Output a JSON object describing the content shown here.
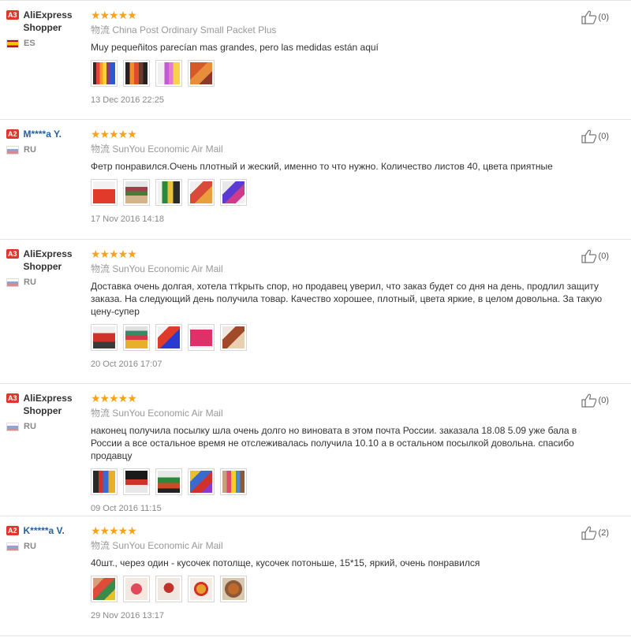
{
  "reviews": [
    {
      "level": "A3",
      "name": "AliExpress Shopper",
      "masked": false,
      "country": "ES",
      "flag": "es",
      "stars": "★★★★★",
      "shipping": "物流 China Post Ordinary Small Packet Plus",
      "text": "Muy pequeñitos parecían mas grandes, pero las medidas están aquí",
      "photos": [
        "linear-gradient(90deg,#3a2a20 0 15%,#e2473a 15% 30%,#f59a2a 30% 45%,#ffd23a 45% 60%,#8b3a7a 60% 75%,#2a5ad0 75% 100%)",
        "linear-gradient(90deg,#2a2020 0 20%,#f28c28 20% 40%,#e34a33 40% 60%,#6a3a2a 60% 80%,#222 80% 100%)",
        "linear-gradient(90deg,#f0f0f0 0 30%,#c15ad4 30% 50%,#e67acb 50% 70%,#f7d24a 70% 100%)",
        "linear-gradient(135deg,#d25a2a 0 40%,#e88e3a 40% 70%,#8a3a2a 70% 100%)"
      ],
      "date": "13 Dec 2016 22:25",
      "helpful": "(0)"
    },
    {
      "level": "A2",
      "name": "M****a Y.",
      "masked": true,
      "country": "RU",
      "flag": "ru",
      "stars": "★★★★★",
      "shipping": "物流 SunYou Economic Air Mail",
      "text": "Фетр понравился.Очень плотный и жеский, именно то что нужно. Количество листов 40, цвета приятные",
      "photos": [
        "linear-gradient(180deg,#f2f2f2 0 35%,#e23a2a 35% 100%)",
        "linear-gradient(180deg,#e6e6e6 0 25%,#a83a4a 25% 45%,#4a7a3a 45% 65%,#d4b48a 65% 100%)",
        "linear-gradient(90deg,#f0f0f0 0 20%,#2a8a3a 20% 45%,#e8c23a 45% 70%,#2a2a2a 70% 100%)",
        "linear-gradient(135deg,#f0f0f0 0 30%,#d84a3a 30% 60%,#e8a03a 60% 100%)",
        "linear-gradient(135deg,#e8e8e8 0 30%,#5a3ad0 30% 55%,#d03a8a 55% 80%,#f0f0f0 80% 100%)"
      ],
      "date": "17 Nov 2016 14:18",
      "helpful": "(0)"
    },
    {
      "level": "A3",
      "name": "AliExpress Shopper",
      "masked": false,
      "country": "RU",
      "flag": "ru",
      "stars": "★★★★★",
      "shipping": "物流 SunYou Economic Air Mail",
      "text": "Доставка очень долгая, хотела ттkрыть спор, но продавец уверил, что заказ будет со дня на день, продлил защиту заказа. На следующий день получила товар. Качество хорошее, плотный, цвета яркие, в целом довольна. За такую цену-супер",
      "photos": [
        "linear-gradient(180deg,#f0f0f0 0 30%,#d0322a 30% 70%,#3a3a3a 70% 100%)",
        "linear-gradient(180deg,#e0e0e0 0 20%,#3a8a6a 20% 40%,#d03a4a 40% 60%,#e8b02a 60% 100%)",
        "linear-gradient(135deg,#f0f0f0 0 25%,#e03a2a 25% 55%,#2a3ad0 55% 100%)",
        "linear-gradient(180deg,#f4f4f4 0 15%,#e0306a 15% 90%,#f4f4f4 90% 100%)",
        "linear-gradient(135deg,#f0e8e0 0 30%,#a04a2a 30% 60%,#e8d0b0 60% 100%)"
      ],
      "date": "20 Oct 2016 17:07",
      "helpful": "(0)"
    },
    {
      "level": "A3",
      "name": "AliExpress Shopper",
      "masked": false,
      "country": "RU",
      "flag": "ru",
      "stars": "★★★★★",
      "shipping": "物流 SunYou Economic Air Mail",
      "text": "наконец получила посылку шла очень долго но виновата в этом почта России. заказала 18.08 5.09 уже бала в России а все остальное время не отслеживалась получила 10.10 а в остальном посылкой довольна. спасибо продавцу",
      "photos": [
        "linear-gradient(90deg,#2a2a2a 0 25%,#d0322a 25% 45%,#3a6ad0 45% 70%,#e8b02a 70% 100%)",
        "linear-gradient(180deg,#1a1a1a 0 40%,#d0322a 40% 65%,#e8e8e8 65% 100%)",
        "linear-gradient(180deg,#e8e8e8 0 30%,#2a8a3a 30% 55%,#d04a2a 55% 80%,#222 80% 100%)",
        "linear-gradient(135deg,#e8c02a 0 25%,#3a6ad0 25% 50%,#d0322a 50% 75%,#8a3ad0 75% 100%)",
        "linear-gradient(90deg,#c8a07a 0 20%,#e04a6a 20% 40%,#f0d02a 40% 60%,#4a8ad0 60% 80%,#8a5a3a 80% 100%)"
      ],
      "date": "09 Oct 2016 11:15",
      "helpful": "(0)"
    },
    {
      "level": "A2",
      "name": "K*****a V.",
      "masked": true,
      "country": "RU",
      "flag": "ru",
      "stars": "★★★★★",
      "shipping": "物流 SunYou Economic Air Mail",
      "text": "40шт., через один - кусочек потолще, кусочек потоньше, 15*15, яркий, очень понравился",
      "photos": [
        "linear-gradient(135deg,#d8a07a 0 25%,#e04a3a 25% 50%,#3a8a4a 50% 75%,#e8c02a 75% 100%)",
        "radial-gradient(circle at 50% 50%,#e04a5a 0 35%,#f4e8e0 36% 100%)",
        "radial-gradient(circle at 50% 45%,#c0322a 0 30%,#f0e8e0 31% 100%)",
        "radial-gradient(circle at 50% 50%,#e8a02a 0 30%,#d0322a 31% 45%,#f4ece4 46% 100%)",
        "radial-gradient(circle at 50% 50%,#c06a2a 0 35%,#8a5a3a 36% 55%,#d8c8b0 56% 100%)"
      ],
      "date": "29 Nov 2016 13:17",
      "helpful": "(2)"
    }
  ]
}
